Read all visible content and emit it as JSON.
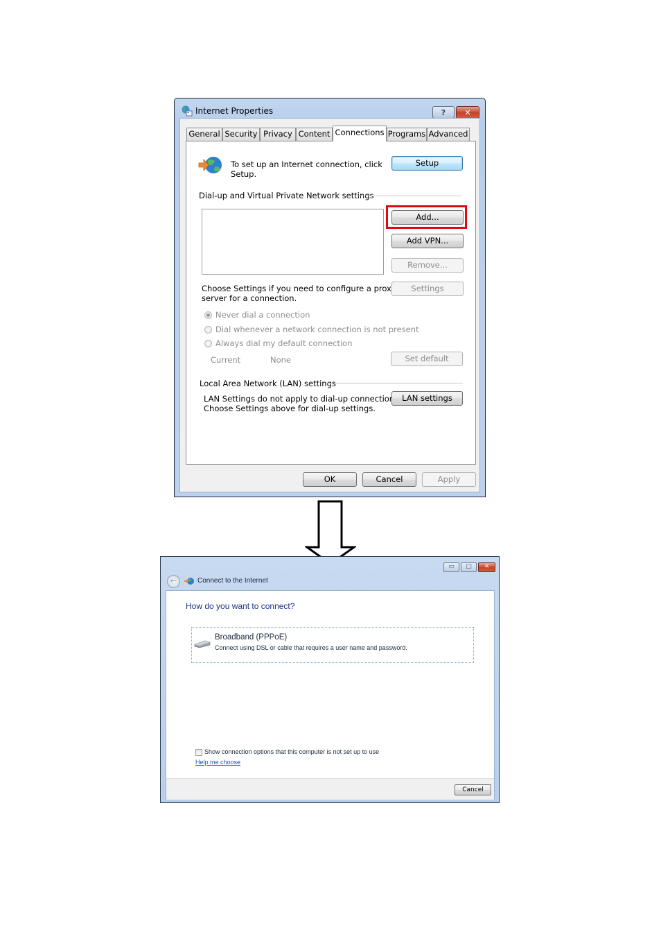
{
  "internet_properties": {
    "title": "Internet Properties",
    "caption_buttons": {
      "help": "?",
      "close": "✕"
    },
    "tabs": [
      {
        "label": "General",
        "active": false
      },
      {
        "label": "Security",
        "active": false
      },
      {
        "label": "Privacy",
        "active": false
      },
      {
        "label": "Content",
        "active": false
      },
      {
        "label": "Connections",
        "active": true
      },
      {
        "label": "Programs",
        "active": false
      },
      {
        "label": "Advanced",
        "active": false
      }
    ],
    "setup": {
      "text_line1": "To set up an Internet connection, click",
      "text_line2": "Setup.",
      "button": "Setup"
    },
    "dialup_section": {
      "heading": "Dial-up and Virtual Private Network settings",
      "connections": [],
      "add_button": "Add...",
      "add_vpn_button": "Add VPN...",
      "remove_button": "Remove...",
      "settings_button": "Settings",
      "proxy_text_line1": "Choose Settings if you need to configure a proxy",
      "proxy_text_line2": "server for a connection.",
      "radio_options": [
        {
          "label": "Never dial a connection",
          "checked": true
        },
        {
          "label": "Dial whenever a network connection is not present",
          "checked": false
        },
        {
          "label": "Always dial my default connection",
          "checked": false
        }
      ],
      "current_label": "Current",
      "current_value": "None",
      "set_default_button": "Set default"
    },
    "lan_section": {
      "heading": "Local Area Network (LAN) settings",
      "text_line1": "LAN Settings do not apply to dial-up connections.",
      "text_line2": "Choose Settings above for dial-up settings.",
      "button": "LAN settings"
    },
    "footer": {
      "ok": "OK",
      "cancel": "Cancel",
      "apply": "Apply"
    },
    "highlight_color": "#e30613"
  },
  "connect_wizard": {
    "title": "Connect to the Internet",
    "caption_buttons": {
      "minimize": "▭",
      "maximize": "□",
      "close": "✕"
    },
    "heading": "How do you want to connect?",
    "options": [
      {
        "title": "Broadband (PPPoE)",
        "description": "Connect using DSL or cable that requires a user name and password.",
        "icon": "modem-icon"
      }
    ],
    "show_options_checkbox": {
      "label": "Show connection options that this computer is not set up to use",
      "checked": false
    },
    "help_link": "Help me choose",
    "cancel_button": "Cancel",
    "heading_color": "#1e3287"
  }
}
